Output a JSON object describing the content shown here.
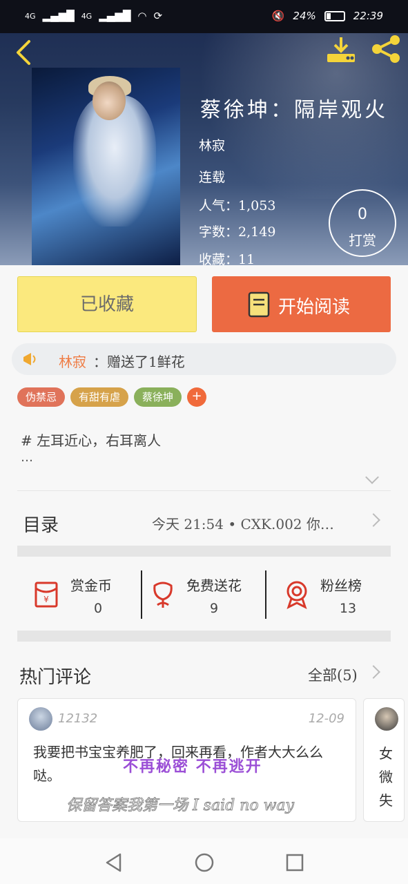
{
  "status_bar": {
    "network_1": "4G",
    "network_2": "4G",
    "battery": "24%",
    "time": "22:39"
  },
  "book": {
    "title": "蔡徐坤：隔岸观火",
    "author": "林寂",
    "status": "连载",
    "popularity_label": "人气",
    "popularity_value": "1,053",
    "words_label": "字数",
    "words_value": "2,149",
    "collect_label": "收藏",
    "collect_value": "11",
    "sep": "："
  },
  "tip": {
    "count": "0",
    "label": "打赏"
  },
  "actions": {
    "collected": "已收藏",
    "start_reading": "开始阅读"
  },
  "gift": {
    "user": "林寂",
    "text": "：赠送了1鲜花"
  },
  "tags": [
    {
      "label": "伪禁忌",
      "color": "#e0735a"
    },
    {
      "label": "有甜有虐",
      "color": "#d6a24a"
    },
    {
      "label": "蔡徐坤",
      "color": "#8ab05b"
    }
  ],
  "tag_add": "+",
  "intro": {
    "text": "# 左耳近心，右耳离人",
    "more": "…"
  },
  "toc": {
    "label": "目录",
    "latest": "今天 21:54 • CXK.002 你…"
  },
  "stats": [
    {
      "label": "赏金币",
      "value": "0"
    },
    {
      "label": "免费送花",
      "value": "9"
    },
    {
      "label": "粉丝榜",
      "value": "13"
    }
  ],
  "comments_section": {
    "title": "热门评论",
    "all_label": "全部(5)"
  },
  "comments": [
    {
      "user": "12132",
      "date": "12-09",
      "body": "我要把书宝宝养肥了，回来再看，作者大大么么哒。"
    }
  ],
  "comment_peek": {
    "lines": [
      "女",
      "微",
      "失"
    ]
  },
  "overlay": {
    "line1": "不再秘密 不再逃开",
    "line2": "保留答案我第一场 I said no way"
  }
}
